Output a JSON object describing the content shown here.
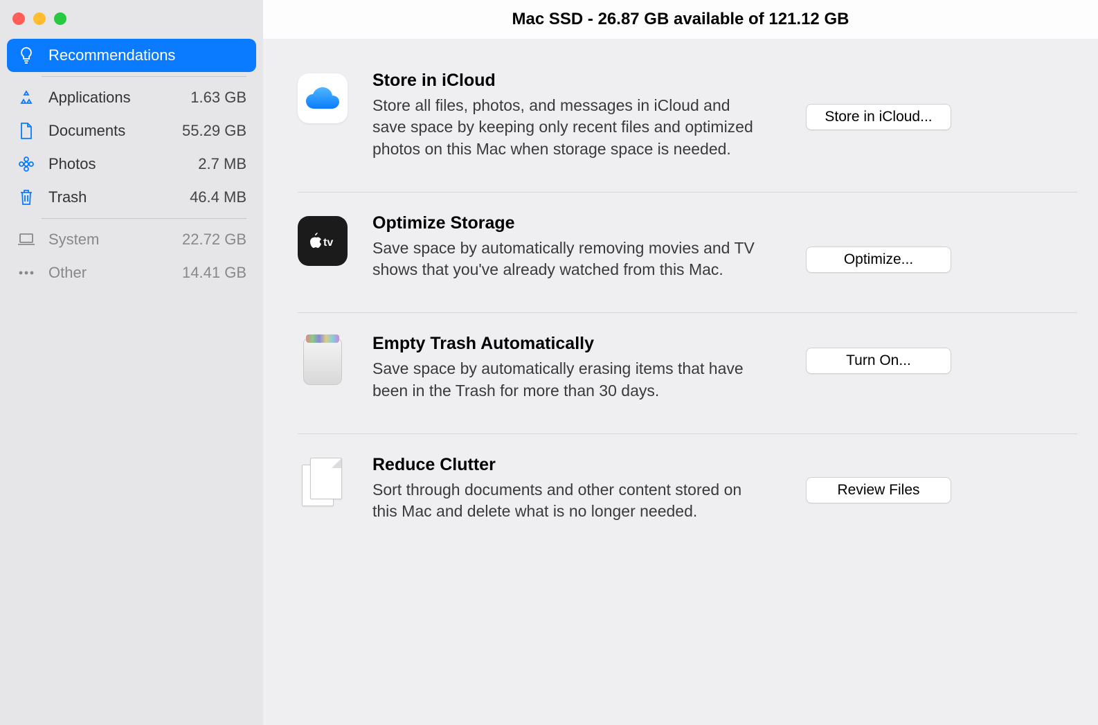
{
  "window": {
    "title": "Mac SSD - 26.87 GB available of 121.12 GB"
  },
  "sidebar": {
    "items": [
      {
        "id": "recommendations",
        "label": "Recommendations",
        "size": "",
        "icon": "lightbulb",
        "selected": true
      },
      {
        "id": "applications",
        "label": "Applications",
        "size": "1.63 GB",
        "icon": "app",
        "selected": false
      },
      {
        "id": "documents",
        "label": "Documents",
        "size": "55.29 GB",
        "icon": "document",
        "selected": false
      },
      {
        "id": "photos",
        "label": "Photos",
        "size": "2.7 MB",
        "icon": "flower",
        "selected": false
      },
      {
        "id": "trash",
        "label": "Trash",
        "size": "46.4 MB",
        "icon": "trash",
        "selected": false
      },
      {
        "id": "system",
        "label": "System",
        "size": "22.72 GB",
        "icon": "laptop",
        "selected": false,
        "dim": true
      },
      {
        "id": "other",
        "label": "Other",
        "size": "14.41 GB",
        "icon": "ellipsis",
        "selected": false,
        "dim": true
      }
    ]
  },
  "recommendations": [
    {
      "id": "icloud",
      "title": "Store in iCloud",
      "desc": "Store all files, photos, and messages in iCloud and save space by keeping only recent files and optimized photos on this Mac when storage space is needed.",
      "button": "Store in iCloud..."
    },
    {
      "id": "optimize",
      "title": "Optimize Storage",
      "desc": "Save space by automatically removing movies and TV shows that you've already watched from this Mac.",
      "button": "Optimize..."
    },
    {
      "id": "empty-trash",
      "title": "Empty Trash Automatically",
      "desc": "Save space by automatically erasing items that have been in the Trash for more than 30 days.",
      "button": "Turn On..."
    },
    {
      "id": "reduce-clutter",
      "title": "Reduce Clutter",
      "desc": "Sort through documents and other content stored on this Mac and delete what is no longer needed.",
      "button": "Review Files"
    }
  ]
}
